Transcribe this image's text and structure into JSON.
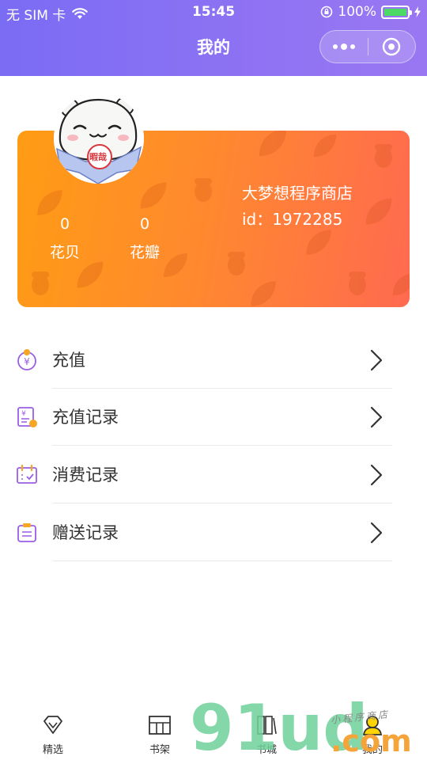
{
  "status_bar": {
    "carrier": "无 SIM 卡",
    "time": "15:45",
    "battery": "100%",
    "battery_level": 1.0
  },
  "nav": {
    "title": "我的"
  },
  "profile": {
    "shop_name": "大梦想程序商店",
    "user_id": "id：1972285",
    "avatar_badge": "暇哉",
    "stats": [
      {
        "value": "0",
        "label": "花贝"
      },
      {
        "value": "0",
        "label": "花瓣"
      }
    ]
  },
  "menu": [
    {
      "label": "充值",
      "icon": "yuan-coin-icon"
    },
    {
      "label": "充值记录",
      "icon": "recharge-record-icon"
    },
    {
      "label": "消费记录",
      "icon": "calendar-check-icon"
    },
    {
      "label": "赠送记录",
      "icon": "gift-record-icon"
    }
  ],
  "tabbar": {
    "items": [
      {
        "label": "精选",
        "icon": "diamond-icon"
      },
      {
        "label": "书架",
        "icon": "bookshelf-icon"
      },
      {
        "label": "书城",
        "icon": "bookstore-icon"
      },
      {
        "label": "我的",
        "icon": "user-icon",
        "active": true
      }
    ]
  },
  "watermark": {
    "brand_num": "91ud",
    "brand_tld": ".com",
    "brand_cn": "小程序商店"
  },
  "colors": {
    "nav_start": "#7b6cf4",
    "nav_end": "#9a77f2",
    "card_start": "#ff9c14",
    "card_end": "#ff6a50",
    "icon_purple": "#9b5de5",
    "icon_orange": "#f6a623"
  }
}
